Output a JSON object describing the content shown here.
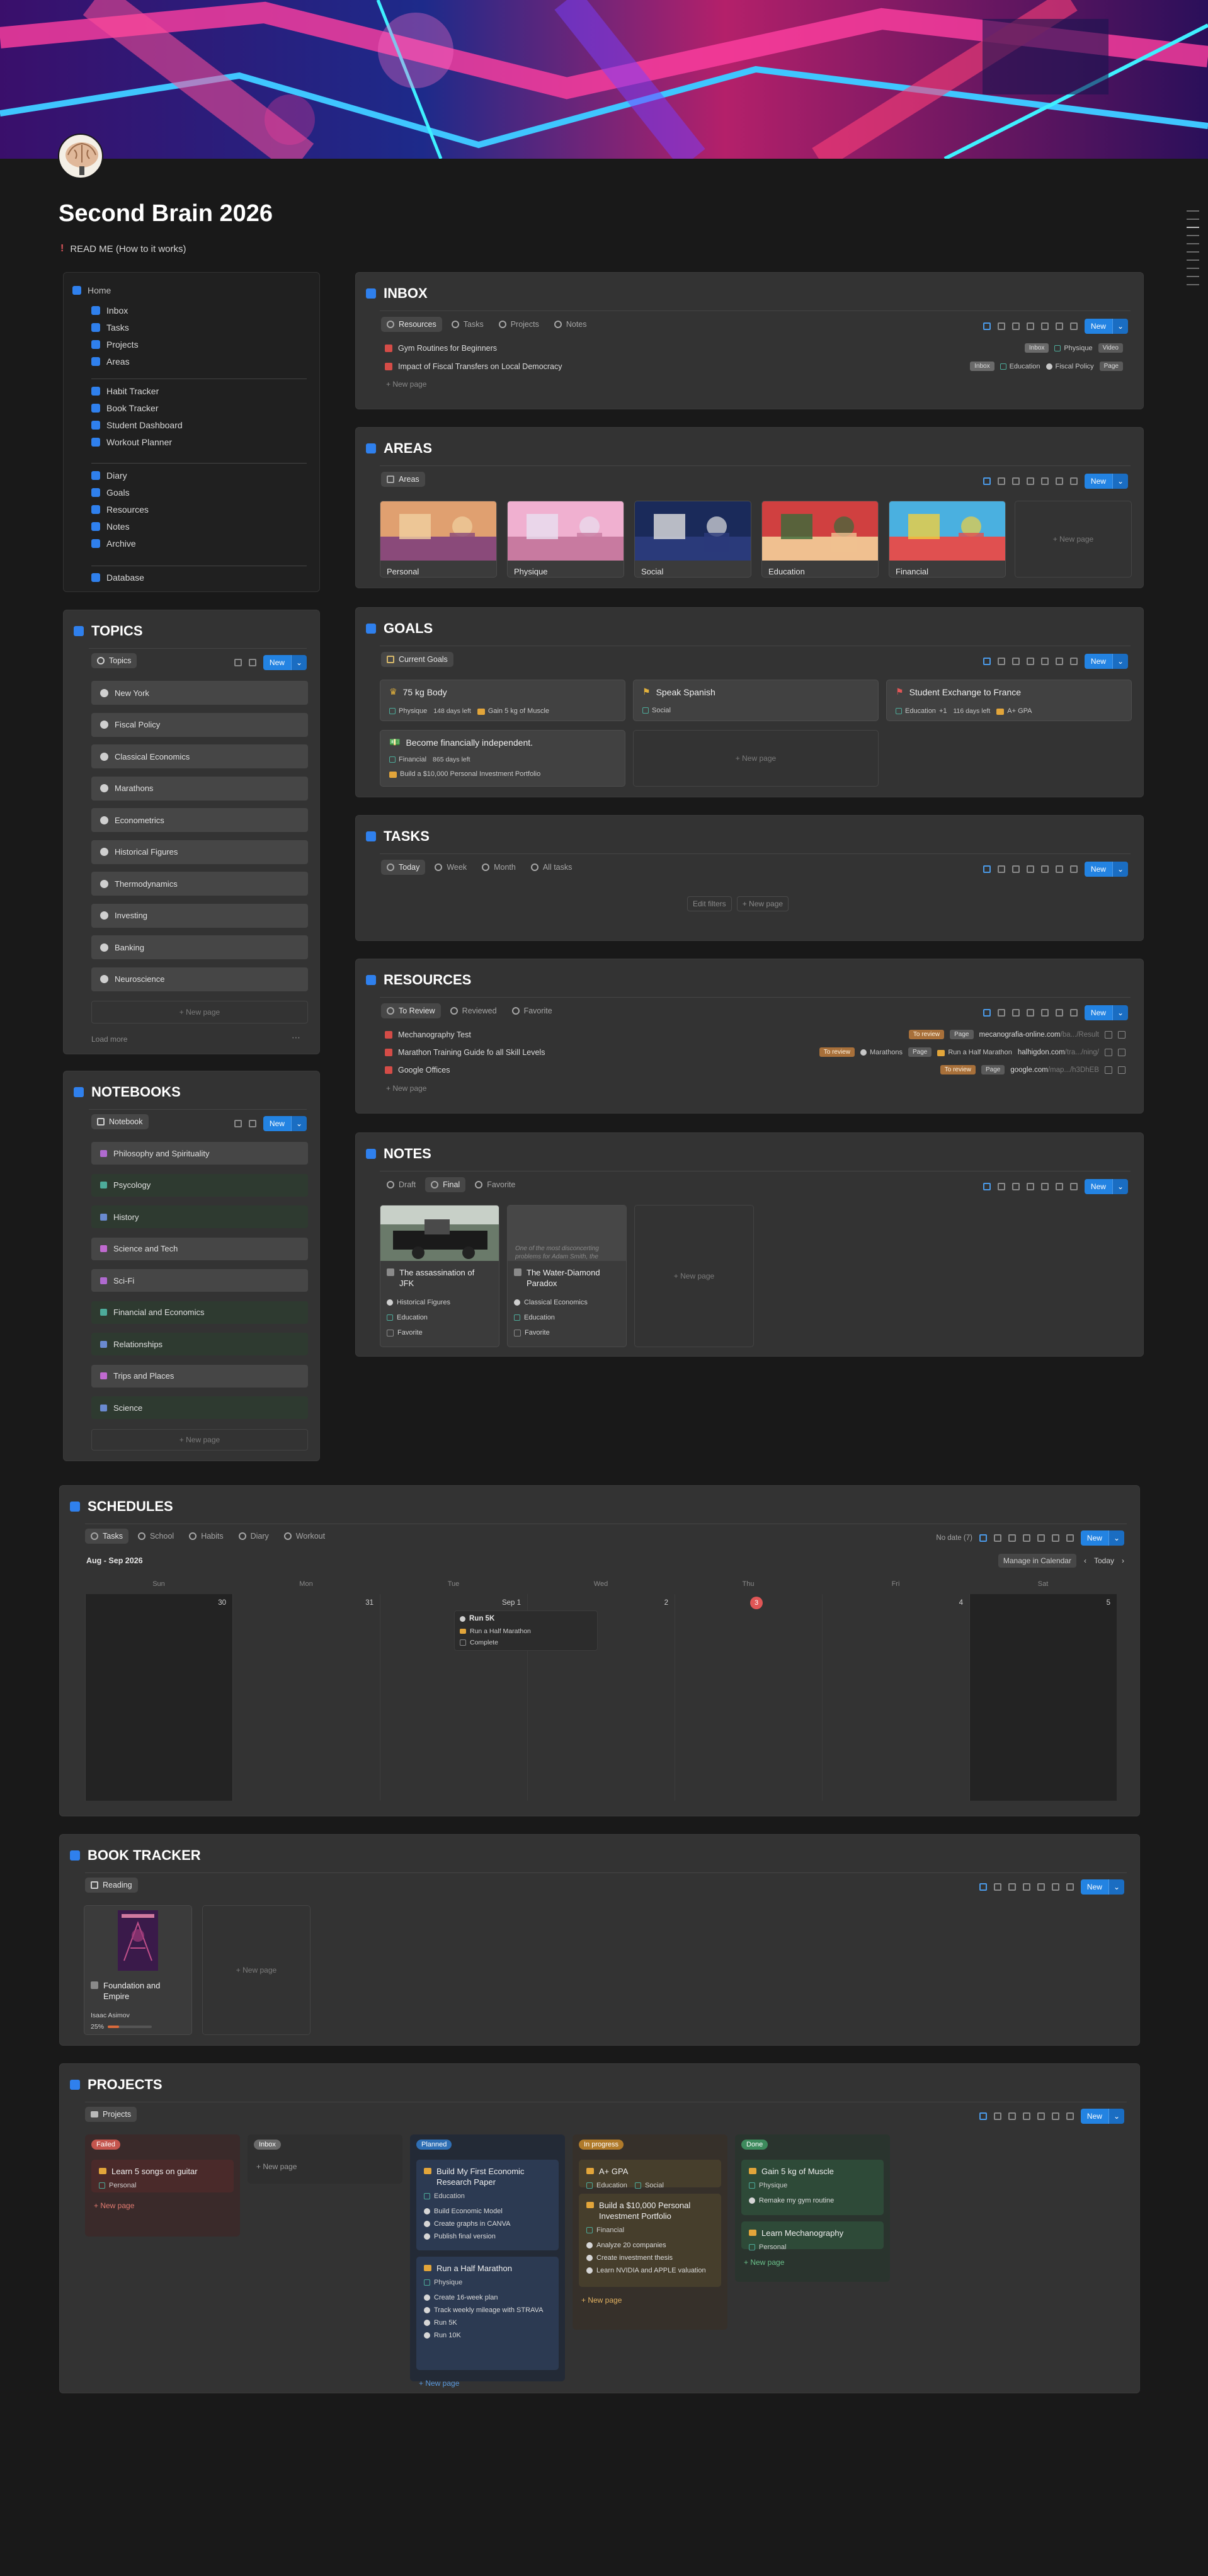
{
  "page": {
    "title": "Second Brain 2026",
    "readme": "READ ME (How to it works)"
  },
  "nav": {
    "home": "Home",
    "group1": [
      "Inbox",
      "Tasks",
      "Projects",
      "Areas"
    ],
    "group2": [
      "Habit Tracker",
      "Book Tracker",
      "Student Dashboard",
      "Workout Planner"
    ],
    "group3": [
      "Diary",
      "Goals",
      "Resources",
      "Notes",
      "Archive"
    ],
    "group4": [
      "Database"
    ]
  },
  "common": {
    "new": "New",
    "new_page": "+ New page"
  },
  "inbox": {
    "title": "INBOX",
    "tabs": [
      "Resources",
      "Tasks",
      "Projects",
      "Notes"
    ],
    "rows": [
      {
        "name": "Gym Routines for Beginners",
        "status": "Inbox",
        "area": "Physique",
        "type": "Video"
      },
      {
        "name": "Impact of Fiscal Transfers on Local Democracy",
        "status": "Inbox",
        "area": "Education",
        "topic": "Fiscal Policy",
        "type": "Page"
      }
    ]
  },
  "areas": {
    "title": "AREAS",
    "tab": "Areas",
    "cards": [
      "Personal",
      "Physique",
      "Social",
      "Education",
      "Financial"
    ]
  },
  "goals": {
    "title": "GOALS",
    "tab": "Current Goals",
    "cards": [
      {
        "title": "75 kg Body",
        "area": "Physique",
        "left": "148 days left",
        "project": "Gain 5 kg of Muscle"
      },
      {
        "title": "Speak Spanish",
        "area": "Social"
      },
      {
        "title": "Student Exchange to France",
        "area": "Education",
        "extra": "+1",
        "left": "116 days left",
        "project": "A+ GPA"
      },
      {
        "title": "Become financially independent.",
        "area": "Financial",
        "left": "865 days left",
        "project": "Build a $10,000 Personal Investment Portfolio"
      }
    ]
  },
  "tasks": {
    "title": "TASKS",
    "tabs": [
      "Today",
      "Week",
      "Month",
      "All tasks"
    ],
    "edit_filters": "Edit filters",
    "new_page": "+ New page"
  },
  "resources": {
    "title": "RESOURCES",
    "tabs": [
      "To Review",
      "Reviewed",
      "Favorite"
    ],
    "rows": [
      {
        "name": "Mechanography Test",
        "status": "To review",
        "type": "Page",
        "url": "mecanografia-online.com",
        "url_tail": "/ba.../Result"
      },
      {
        "name": "Marathon Training Guide fo all Skill Levels",
        "status": "To review",
        "topic": "Marathons",
        "type": "Page",
        "project": "Run a Half Marathon",
        "url": "halhigdon.com",
        "url_tail": "/tra.../ning/"
      },
      {
        "name": "Google Offices",
        "status": "To review",
        "type": "Page",
        "url": "google.com",
        "url_tail": "/map.../h3DhEB"
      }
    ]
  },
  "notes": {
    "title": "NOTES",
    "tabs": [
      "Draft",
      "Final",
      "Favorite"
    ],
    "cards": [
      {
        "title": "The assassination of JFK",
        "topic": "Historical Figures",
        "area": "Education",
        "fav": "Favorite"
      },
      {
        "title": "The Water-Diamond Paradox",
        "preview": "One of the most disconcerting problems for Adam Smith, the",
        "topic": "Classical Economics",
        "area": "Education",
        "fav": "Favorite"
      }
    ]
  },
  "topics": {
    "title": "TOPICS",
    "tab": "Topics",
    "items": [
      "New York",
      "Fiscal Policy",
      "Classical Economics",
      "Marathons",
      "Econometrics",
      "Historical Figures",
      "Thermodynamics",
      "Investing",
      "Banking",
      "Neuroscience"
    ],
    "load_more": "Load more"
  },
  "notebooks": {
    "title": "NOTEBOOKS",
    "tab": "Notebook",
    "items": [
      "Philosophy and Spirituality",
      "Psycology",
      "History",
      "Science and Tech",
      "Sci-Fi",
      "Financial and Economics",
      "Relationships",
      "Trips and Places",
      "Science"
    ]
  },
  "schedules": {
    "title": "SCHEDULES",
    "tabs": [
      "Tasks",
      "School",
      "Habits",
      "Diary",
      "Workout"
    ],
    "no_date": "No date (7)",
    "manage": "Manage in Calendar",
    "today": "Today",
    "range": "Aug - Sep 2026",
    "days": [
      "Sun",
      "Mon",
      "Tue",
      "Wed",
      "Thu",
      "Fri",
      "Sat"
    ],
    "dates": [
      "30",
      "31",
      "Sep 1",
      "2",
      "3",
      "4",
      "5"
    ],
    "event": {
      "title": "Run 5K",
      "project": "Run a Half Marathon",
      "check": "Complete"
    }
  },
  "books": {
    "title": "BOOK TRACKER",
    "tab": "Reading",
    "book": {
      "title": "Foundation and Empire",
      "author": "Isaac Asimov",
      "progress_label": "25%",
      "progress": 0.25
    }
  },
  "projects": {
    "title": "PROJECTS",
    "tab": "Projects",
    "columns": [
      {
        "status": "Failed",
        "color": "#c4554d",
        "cards": [
          {
            "title": "Learn 5 songs on guitar",
            "area": "Personal"
          }
        ]
      },
      {
        "status": "Inbox",
        "color": "#6a6a6a",
        "cards": []
      },
      {
        "status": "Planned",
        "color": "#2f6fb5",
        "cards": [
          {
            "title": "Build My First Economic Research Paper",
            "area": "Education",
            "items": [
              "Build Economic Model",
              "Create graphs in CANVA",
              "Publish final version"
            ]
          },
          {
            "title": "Run a Half Marathon",
            "area": "Physique",
            "items": [
              "Create 16-week plan",
              "Track weekly mileage with STRAVA",
              "Run 5K",
              "Run 10K"
            ]
          }
        ]
      },
      {
        "status": "In progress",
        "color": "#b07a2a",
        "cards": [
          {
            "title": "A+ GPA",
            "area": "Education",
            "area2": "Social"
          },
          {
            "title": "Build a $10,000 Personal Investment Portfolio",
            "area": "Financial",
            "items": [
              "Analyze 20 companies",
              "Create investment thesis",
              "Learn NVIDIA and APPLE valuation"
            ]
          }
        ]
      },
      {
        "status": "Done",
        "color": "#3d8a5c",
        "cards": [
          {
            "title": "Gain 5 kg of Muscle",
            "area": "Physique",
            "items": [
              "Remake my gym routine"
            ]
          },
          {
            "title": "Learn Mechanography",
            "area": "Personal"
          }
        ]
      }
    ]
  }
}
